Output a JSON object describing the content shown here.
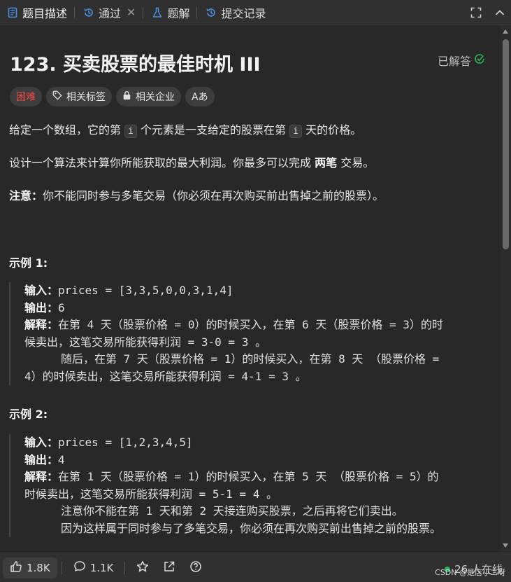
{
  "tabs": [
    {
      "label": "题目描述",
      "icon": "document-icon"
    },
    {
      "label": "通过",
      "icon": "history-icon"
    },
    {
      "label": "题解",
      "icon": "flask-icon"
    },
    {
      "label": "提交记录",
      "icon": "history-icon"
    }
  ],
  "problem": {
    "title": "123. 买卖股票的最佳时机 III",
    "status": "已解答",
    "tags": {
      "difficulty": "困难",
      "topics": "相关标签",
      "companies": "相关企业",
      "translate": "Aあ"
    }
  },
  "description": {
    "p1_a": "给定一个数组，它的第",
    "p1_code1": "i",
    "p1_b": "个元素是一支给定的股票在第",
    "p1_code2": "i",
    "p1_c": "天的价格。",
    "p2_a": "设计一个算法来计算你所能获取的最大利润。你最多可以完成",
    "p2_bold": "两笔",
    "p2_b": "交易。",
    "p3_bold": "注意：",
    "p3_text": "你不能同时参与多笔交易（你必须在再次购买前出售掉之前的股票）。"
  },
  "examples": [
    {
      "title": "示例 1:",
      "input_label": "输入：",
      "input": "prices = [3,3,5,0,0,3,1,4]",
      "output_label": "输出：",
      "output": "6",
      "explain_label": "解释：",
      "explain_lines": [
        "在第 4 天（股票价格 = 0）的时候买入，在第 6 天（股票价格 = 3）的时",
        "候卖出，这笔交易所能获得利润 = 3-0 = 3 。",
        "随后，在第 7 天（股票价格 = 1）的时候买入，在第 8 天 （股票价格 =",
        "4）的时候卖出，这笔交易所能获得利润 = 4-1 = 3 。"
      ]
    },
    {
      "title": "示例 2:",
      "input_label": "输入：",
      "input": "prices = [1,2,3,4,5]",
      "output_label": "输出：",
      "output": "4",
      "explain_label": "解释：",
      "explain_lines": [
        "在第 1 天（股票价格 = 1）的时候买入，在第 5 天 （股票价格 = 5）的",
        "时候卖出，这笔交易所能获得利润 = 5-1 = 4 。",
        "注意你不能在第 1 天和第 2 天接连购买股票，之后再将它们卖出。",
        "因为这样属于同时参与了多笔交易，你必须在再次购买前出售掉之前的股票。"
      ]
    }
  ],
  "footer": {
    "likes": "1.8K",
    "comments": "1.1K",
    "online": "26 人在线",
    "watermark": "CSDN @是店小二呀"
  }
}
